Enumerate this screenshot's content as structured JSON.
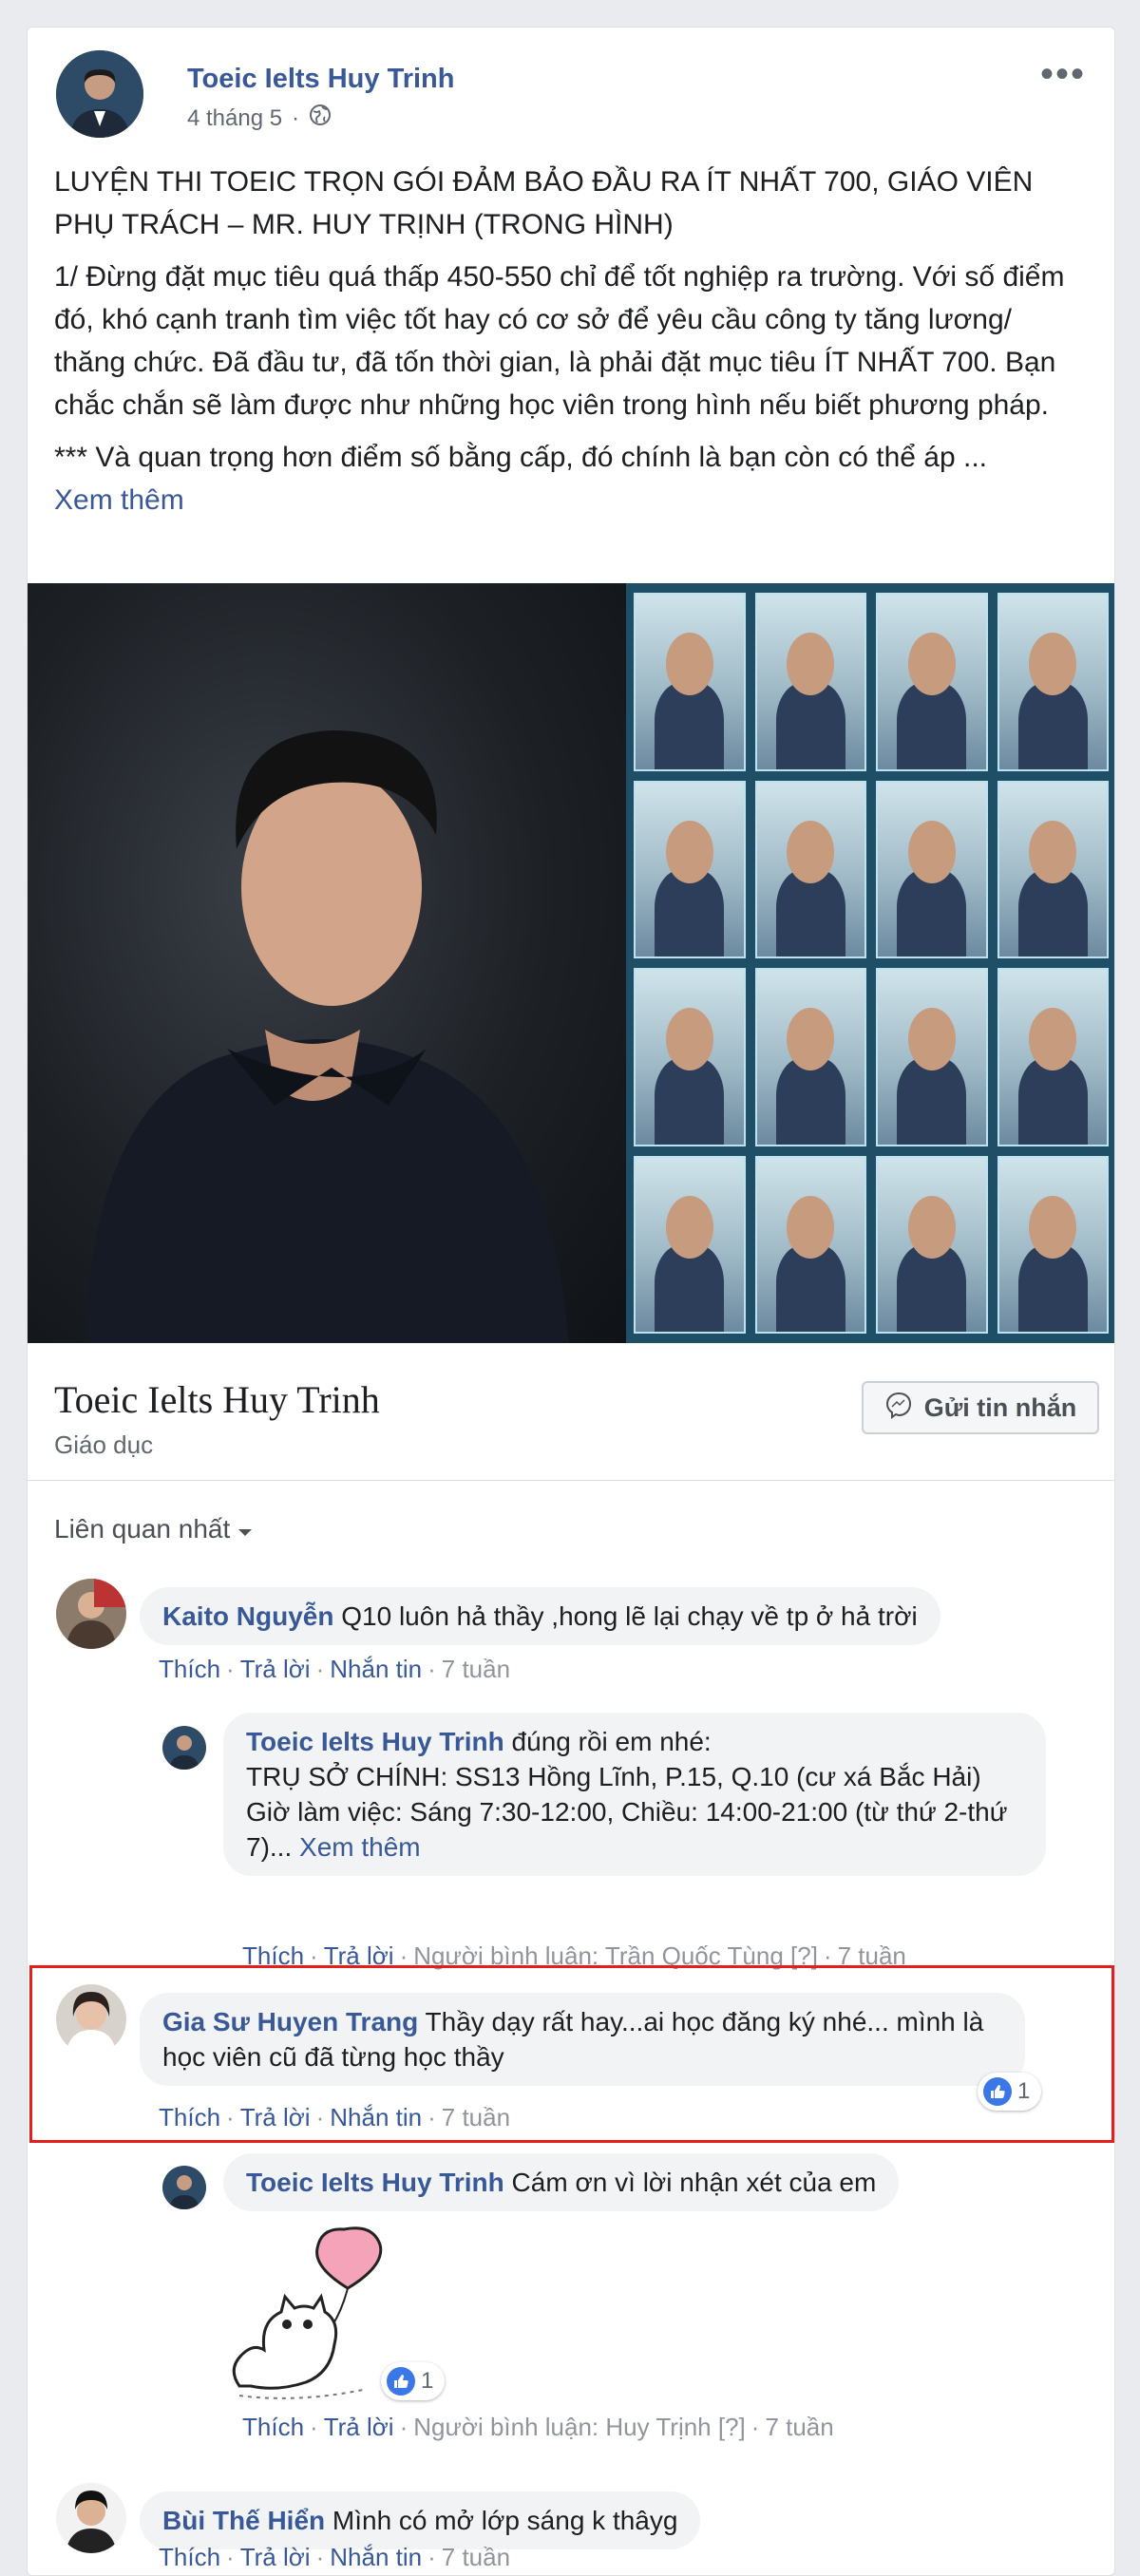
{
  "post": {
    "author": "Toeic Ielts Huy Trinh",
    "date": "4 tháng 5",
    "more": "•••",
    "headline": "LUYỆN THI TOEIC TRỌN GÓI ĐẢM BẢO ĐẦU RA ÍT NHẤT 700, GIÁO VIÊN PHỤ TRÁCH – MR. HUY TRỊNH (TRONG HÌNH)",
    "paragraph1": "1/ Đừng đặt mục tiêu quá thấp 450-550 chỉ để tốt nghiệp ra trường. Với số điểm đó, khó cạnh tranh tìm việc tốt hay có cơ sở để yêu cầu công ty tăng lương/ thăng chức. Đã đầu tư, đã tốn thời gian, là phải đặt mục tiêu ÍT NHẤT 700. Bạn chắc chắn sẽ làm được như những học viên trong hình nếu biết phương pháp.",
    "paragraph2": "*** Và quan trọng hơn điểm số bằng cấp, đó chính là bạn còn có thể áp ...",
    "see_more": "Xem thêm"
  },
  "page_box": {
    "title": "Toeic Ielts Huy Trinh",
    "category": "Giáo dục",
    "message_label": "Gửi tin nhắn"
  },
  "comments_section": {
    "sort_label": "Liên quan nhất",
    "comments": [
      {
        "name": "Kaito Nguyễn",
        "text": "Q10 luôn hả thầy ,hong lẽ lại chạy về tp ở hả trời",
        "actions": [
          "Thích",
          "Trả lời",
          "Nhắn tin",
          "7 tuần"
        ]
      },
      {
        "name": "Toeic Ielts Huy Trinh",
        "text": "đúng rồi em nhé:",
        "line2": "TRỤ SỞ CHÍNH: SS13 Hồng Lĩnh, P.15, Q.10 (cư xá Bắc Hải)",
        "line3": "Giờ làm việc: Sáng 7:30-12:00, Chiều: 14:00-21:00 (từ thứ 2-thứ 7)...",
        "see_more": "Xem thêm",
        "actions": [
          "Thích",
          "Trả lời",
          "Người bình luận: Trần Quốc Tùng [?]",
          "7 tuần"
        ]
      },
      {
        "name": "Gia Sư Huyen Trang",
        "text": "Thầy dạy rất hay...ai học đăng ký nhé... mình là học viên cũ đã từng học thầy",
        "likes": "1",
        "actions": [
          "Thích",
          "Trả lời",
          "Nhắn tin",
          "7 tuần"
        ]
      },
      {
        "name": "Toeic Ielts Huy Trinh",
        "text": "Cám ơn vì lời nhận xét của em",
        "likes": "1",
        "actions": [
          "Thích",
          "Trả lời",
          "Người bình luận: Huy Trịnh [?]",
          "7 tuần"
        ]
      },
      {
        "name": "Bùi Thế Hiển",
        "text": "Mình có mở lớp sáng k thâyg",
        "actions": [
          "Thích",
          "Trả lời",
          "Nhắn tin",
          "7 tuần"
        ]
      }
    ]
  },
  "colors": {
    "link": "#385898",
    "highlight_border": "#e41d1d",
    "bubble": "#f2f3f5",
    "like_blue": "#3b78e7"
  },
  "icons": [
    "globe-icon",
    "more-options-icon",
    "messenger-icon",
    "caret-down-icon",
    "like-icon",
    "cat-balloon-sticker"
  ]
}
